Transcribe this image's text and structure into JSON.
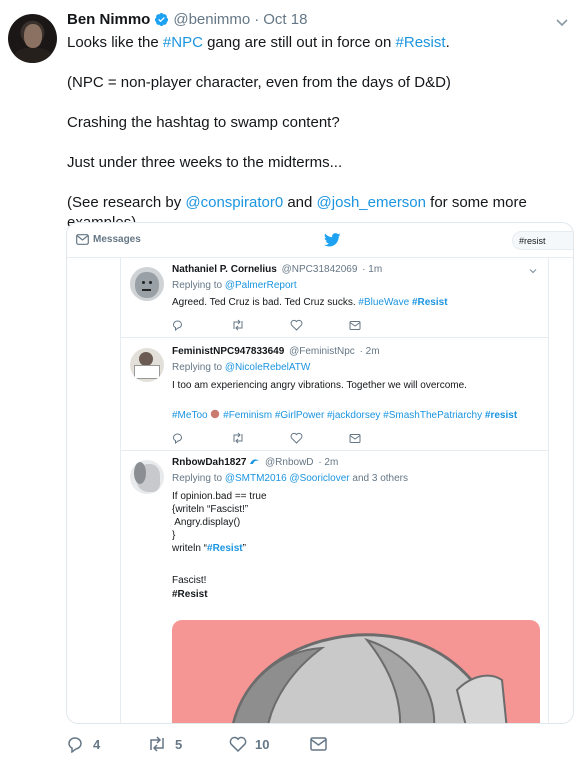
{
  "tweet": {
    "author_name": "Ben Nimmo",
    "handle": "@benimmo",
    "separator": "·",
    "date": "Oct 18",
    "body": {
      "l1_a": "Looks like the ",
      "l1_tag": "#NPC",
      "l1_b": " gang are still out in force on ",
      "l1_tag2": "#Resist",
      "l1_c": ".",
      "l2": "(NPC = non-player character, even from the days of D&D)",
      "l3": "Crashing the hashtag to swamp content?",
      "l4": "Just under three weeks to the midterms...",
      "l5_a": "(See research by ",
      "l5_m1": "@conspirator0",
      "l5_b": " and ",
      "l5_m2": "@josh_emerson",
      "l5_c": " for some more examples)"
    },
    "actions": {
      "replies": "4",
      "retweets": "5",
      "likes": "10"
    }
  },
  "screenshot": {
    "nav_messages": "Messages",
    "search_value": "#resist",
    "tweets": [
      {
        "name": "Nathaniel P. Cornelius",
        "handle": "@NPC31842069",
        "time": "· 1m",
        "replying_prefix": "Replying to ",
        "replying_to": "@PalmerReport",
        "text_a": "Agreed. Ted Cruz is bad. Ted Cruz sucks. ",
        "tag1": "#BlueWave",
        "tag2": "#Resist"
      },
      {
        "name": "FeministNPC947833649",
        "handle": "@FeministNpc",
        "time": "· 2m",
        "replying_prefix": "Replying to ",
        "replying_to": "@NicoleRebelATW",
        "text": "I too am experiencing angry vibrations. Together we will overcome.",
        "tags_a": "#MeToo",
        "tags_b": " #Feminism #GirlPower #jackdorsey #SmashThePatriarchy ",
        "tags_c": "#resist"
      },
      {
        "name": "RnbowDah1827",
        "handle": "@RnbowD",
        "time": "· 2m",
        "replying_prefix": "Replying to ",
        "replying_to": "@SMTM2016 @Sooriclover",
        "replying_suffix": " and 3 others",
        "code1": "If opinion.bad == true",
        "code2": "{writeln “Fascist!”",
        "code3": " Angry.display()",
        "code4": "}",
        "code5_a": "writeln “",
        "code5_tag": "#Resist",
        "code5_b": "”",
        "out1": "Fascist!",
        "out2": "#Resist"
      }
    ]
  },
  "colors": {
    "link": "#1b95e0",
    "muted": "#657786",
    "text": "#14171a",
    "image_pink": "#f59694"
  }
}
